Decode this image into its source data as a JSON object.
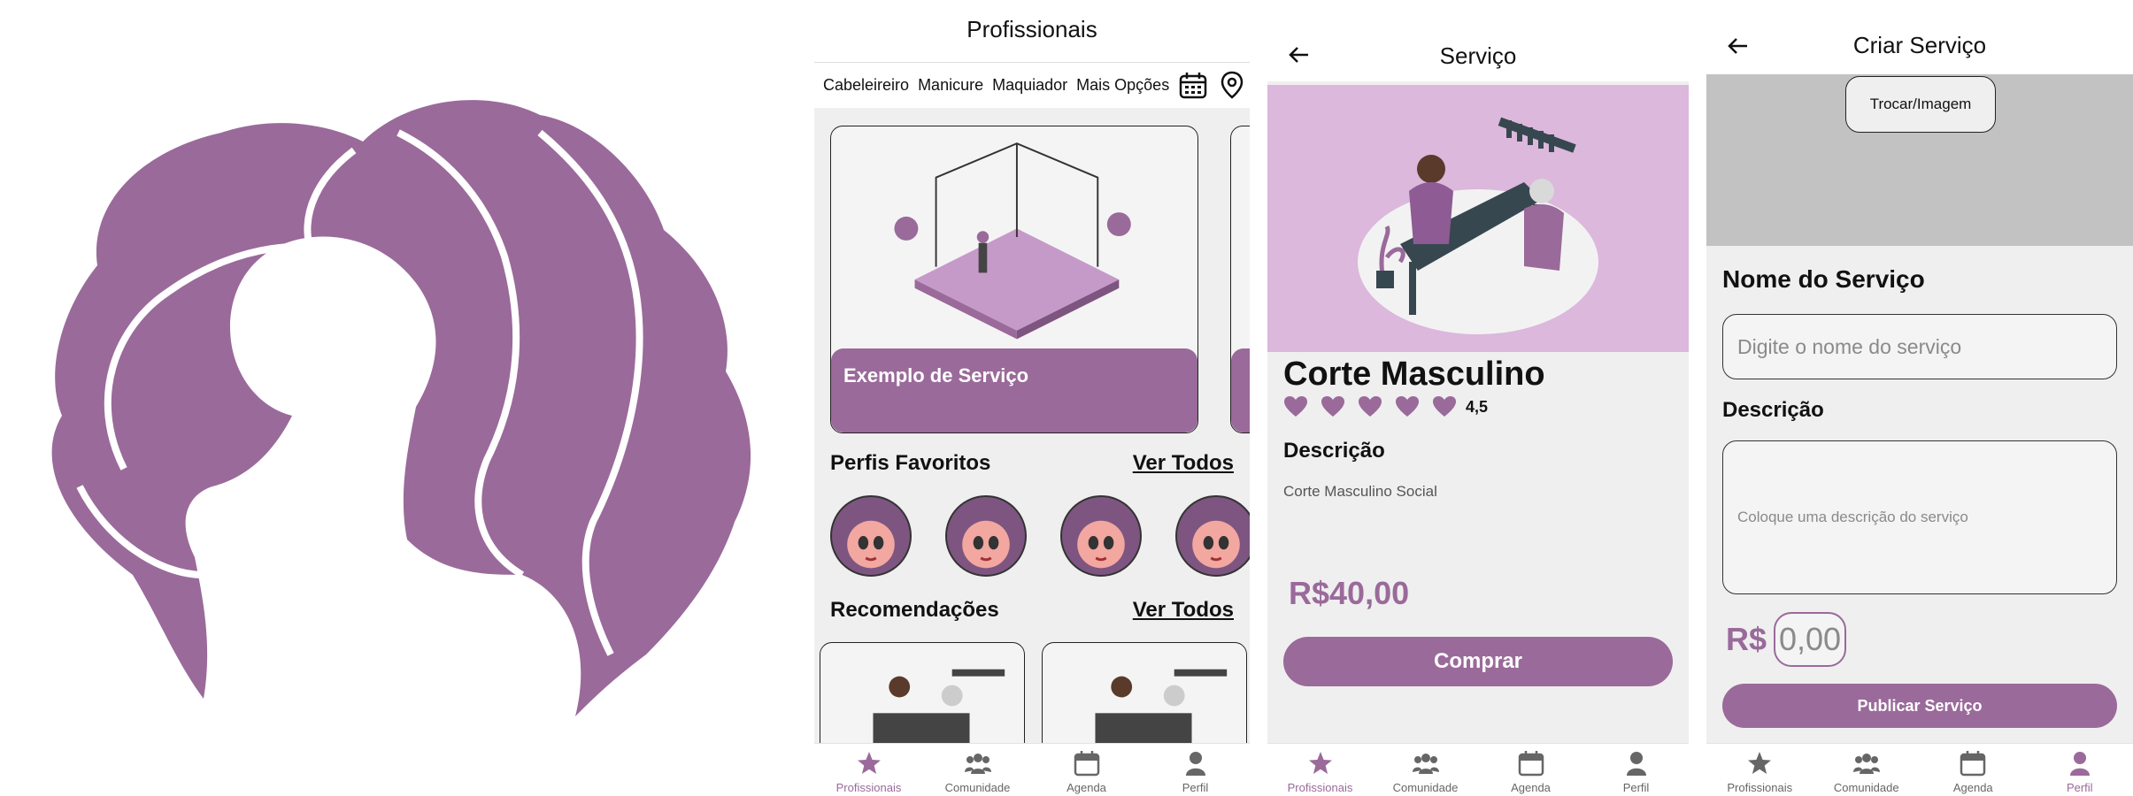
{
  "colors": {
    "accent": "#9a6a9a",
    "hero_bg": "#dbb8dc",
    "inactive": "#666666"
  },
  "logo": {
    "icon": "salon-hair-logo"
  },
  "screen_profissionais": {
    "title": "Profissionais",
    "categories": [
      "Cabeleireiro",
      "Manicure",
      "Maquiador",
      "Mais Opções"
    ],
    "category_icons": [
      "calendar-icon",
      "location-pin-icon"
    ],
    "featured_card_label": "Exemplo de Serviço",
    "favorites_heading": "Perfis Favoritos",
    "favorites_link": "Ver Todos",
    "recommendations_heading": "Recomendações",
    "recommendations_link": "Ver Todos"
  },
  "screen_servico": {
    "title": "Serviço",
    "service_name": "Corte Masculino",
    "rating": "4,5",
    "rating_hearts": 5,
    "description_heading": "Descrição",
    "description": "Corte Masculino Social",
    "price": "R$40,00",
    "buy_button": "Comprar"
  },
  "screen_criar": {
    "title": "Criar Serviço",
    "swap_image_button": "Trocar/Imagem",
    "name_label": "Nome do Serviço",
    "name_placeholder": "Digite o nome do serviço",
    "description_label": "Descrição",
    "description_placeholder": "Coloque uma descrição do serviço",
    "currency": "R$",
    "price_placeholder": "0,00",
    "publish_button": "Publicar Serviço"
  },
  "bottom_nav": {
    "items": [
      {
        "label": "Profissionais",
        "icon": "star-icon"
      },
      {
        "label": "Comunidade",
        "icon": "community-icon"
      },
      {
        "label": "Agenda",
        "icon": "calendar-icon"
      },
      {
        "label": "Perfil",
        "icon": "user-icon"
      }
    ]
  }
}
